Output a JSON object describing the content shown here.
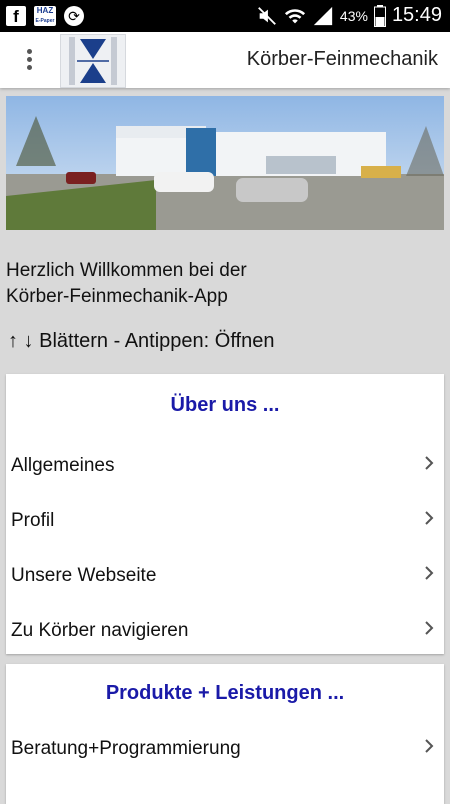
{
  "status_bar": {
    "left_icons": [
      "facebook-icon",
      "haz-epaper-icon",
      "sync-icon"
    ],
    "haz_top": "HAZ",
    "haz_bottom": "E-Paper",
    "right_icons": [
      "mute-icon",
      "wifi-icon",
      "signal-icon",
      "battery-icon"
    ],
    "battery": "43%",
    "time": "15:49"
  },
  "app_bar": {
    "title": "Körber-Feinmechanik",
    "menu_icon": "overflow-menu-icon",
    "logo": "koerber-logo"
  },
  "welcome": {
    "line1": "Herzlich Willkommen bei der",
    "line2": "Körber-Feinmechanik-App"
  },
  "hint": "↑ ↓ Blättern - Antippen: Öffnen",
  "sections": [
    {
      "title": "Über uns ...",
      "items": [
        "Allgemeines",
        "Profil",
        "Unsere Webseite",
        "Zu Körber navigieren"
      ]
    },
    {
      "title": "Produkte + Leistungen ...",
      "items": [
        "Beratung+Programmierung"
      ]
    }
  ],
  "colors": {
    "accent": "#1a1aa8",
    "background": "#d9d9d9",
    "status_bar": "#000000"
  }
}
